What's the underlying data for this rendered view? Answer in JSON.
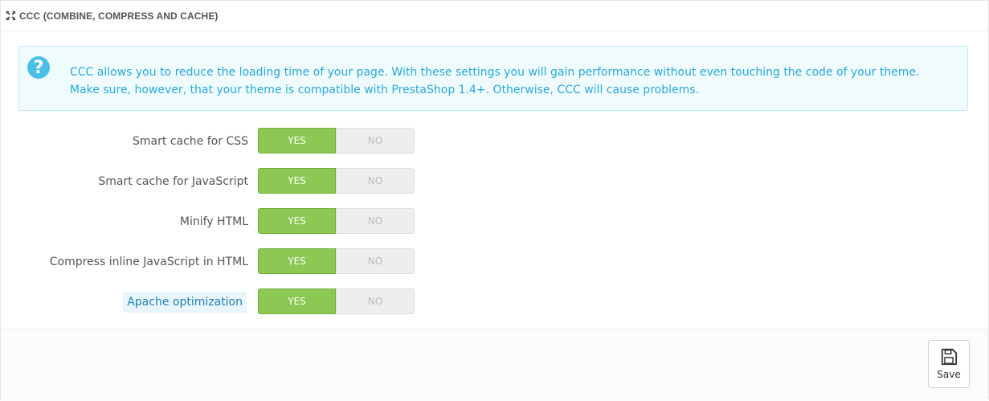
{
  "panel": {
    "title": "CCC (COMBINE, COMPRESS AND CACHE)",
    "title_icon": "expand-arrows-icon"
  },
  "alert": {
    "icon": "question-circle-icon",
    "text": "CCC allows you to reduce the loading time of your page. With these settings you will gain performance without even touching the code of your theme. Make sure, however, that your theme is compatible with PrestaShop 1.4+. Otherwise, CCC will cause problems."
  },
  "settings": [
    {
      "label": "Smart cache for CSS",
      "yes": "YES",
      "no": "NO",
      "value": "YES"
    },
    {
      "label": "Smart cache for JavaScript",
      "yes": "YES",
      "no": "NO",
      "value": "YES"
    },
    {
      "label": "Minify HTML",
      "yes": "YES",
      "no": "NO",
      "value": "YES"
    },
    {
      "label": "Compress inline JavaScript in HTML",
      "yes": "YES",
      "no": "NO",
      "value": "YES"
    },
    {
      "label": "Apache optimization",
      "yes": "YES",
      "no": "NO",
      "value": "YES"
    }
  ],
  "footer": {
    "save_label": "Save",
    "save_icon": "floppy-disk-icon"
  },
  "colors": {
    "yes_active": "#8bc954",
    "alert_text": "#2aa9d9",
    "alert_bg": "#f0fbfe"
  }
}
